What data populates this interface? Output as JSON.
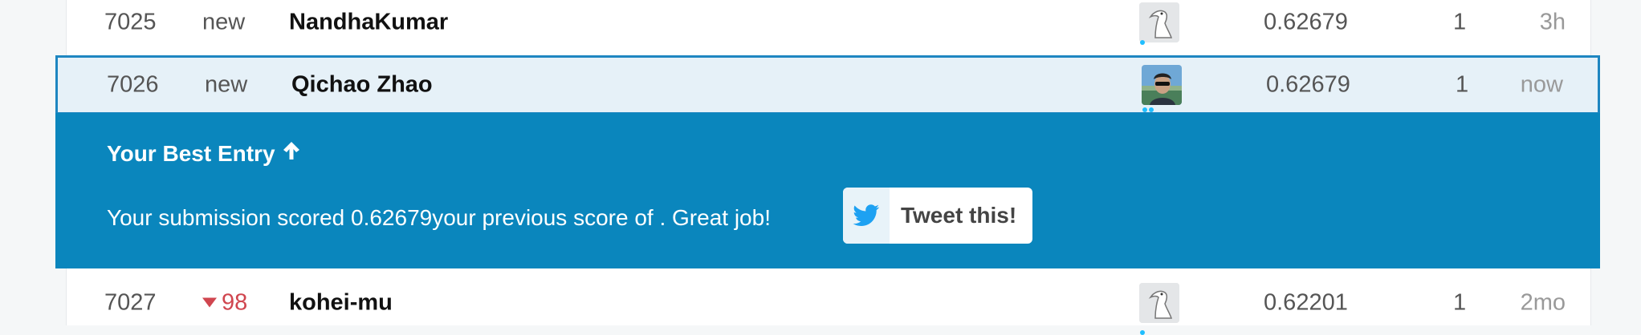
{
  "rows": [
    {
      "rank": "7025",
      "delta": "new",
      "name": "NandhaKumar",
      "score": "0.62679",
      "entries": "1",
      "last": "3h",
      "avatar": "default-avatar-icon"
    },
    {
      "rank": "7026",
      "delta": "new",
      "name": "Qichao Zhao",
      "score": "0.62679",
      "entries": "1",
      "last": "now",
      "avatar": "user-photo"
    },
    {
      "rank": "7027",
      "delta": "98",
      "delta_direction": "down",
      "name": "kohei-mu",
      "score": "0.62201",
      "entries": "1",
      "last": "2mo",
      "avatar": "default-avatar-icon"
    }
  ],
  "banner": {
    "title": "Your Best Entry",
    "message": "Your submission scored 0.62679your previous score of . Great job!",
    "tweet_label": "Tweet this!"
  },
  "colors": {
    "banner_bg": "#0a86bd",
    "highlight_bg": "#e6f1f8",
    "highlight_border": "#1e86c1",
    "delta_down": "#d0464f",
    "tier_dot": "#20beff"
  }
}
